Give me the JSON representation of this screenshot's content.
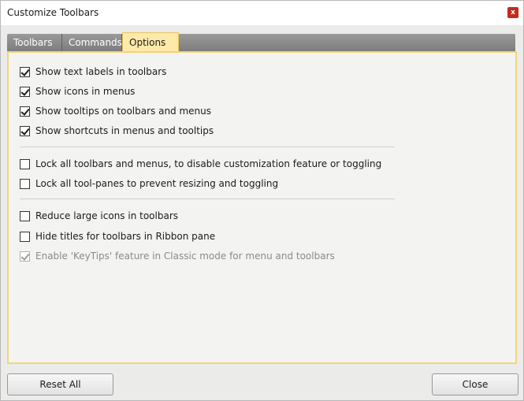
{
  "window": {
    "title": "Customize Toolbars",
    "close_glyph": "x"
  },
  "tabs": [
    {
      "label": "Toolbars",
      "active": false
    },
    {
      "label": "Commands",
      "active": false
    },
    {
      "label": "Options",
      "active": true
    }
  ],
  "options": {
    "group1": [
      {
        "label": "Show text labels in toolbars",
        "checked": true,
        "enabled": true
      },
      {
        "label": "Show icons in menus",
        "checked": true,
        "enabled": true
      },
      {
        "label": "Show tooltips on toolbars and menus",
        "checked": true,
        "enabled": true
      },
      {
        "label": "Show shortcuts in menus and tooltips",
        "checked": true,
        "enabled": true
      }
    ],
    "group2": [
      {
        "label": "Lock all toolbars and menus, to disable customization feature or toggling",
        "checked": false,
        "enabled": true
      },
      {
        "label": "Lock all tool-panes to prevent resizing and toggling",
        "checked": false,
        "enabled": true
      }
    ],
    "group3": [
      {
        "label": "Reduce large icons in toolbars",
        "checked": false,
        "enabled": true
      },
      {
        "label": "Hide titles for toolbars in Ribbon pane",
        "checked": false,
        "enabled": true
      },
      {
        "label": "Enable 'KeyTips' feature in Classic mode for menu and toolbars",
        "checked": true,
        "enabled": false
      }
    ]
  },
  "buttons": {
    "reset_label": "Reset All",
    "close_label": "Close"
  },
  "colors": {
    "active_tab": "#fde9a8",
    "panel_border": "#f2d57a",
    "close_button": "#c42b1c"
  }
}
